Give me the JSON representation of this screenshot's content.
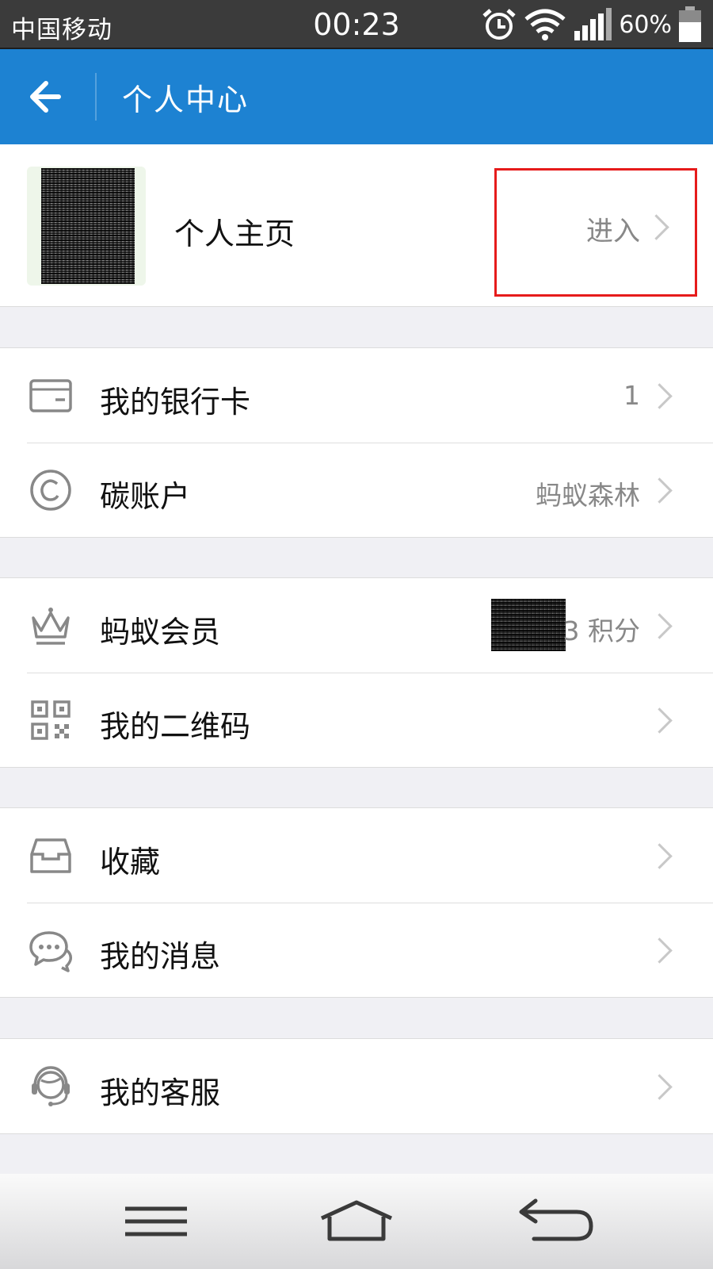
{
  "status_bar": {
    "carrier": "中国移动",
    "time": "00:23",
    "battery": "60%",
    "icons": [
      "alarm-icon",
      "wifi-icon",
      "signal-icon",
      "battery-icon"
    ]
  },
  "header": {
    "back_icon": "back-arrow-icon",
    "title": "个人中心"
  },
  "profile": {
    "title": "个人主页",
    "action": "进入"
  },
  "groups": [
    {
      "rows": [
        {
          "icon": "bank-card-icon",
          "label": "我的银行卡",
          "value": "1"
        },
        {
          "icon": "copyright-c-icon",
          "label": "碳账户",
          "value": "蚂蚁森林"
        }
      ]
    },
    {
      "rows": [
        {
          "icon": "crown-icon",
          "label": "蚂蚁会员",
          "value": "3 积分"
        },
        {
          "icon": "qr-code-icon",
          "label": "我的二维码",
          "value": ""
        }
      ]
    },
    {
      "rows": [
        {
          "icon": "inbox-tray-icon",
          "label": "收藏",
          "value": ""
        },
        {
          "icon": "chat-bubbles-icon",
          "label": "我的消息",
          "value": ""
        }
      ]
    },
    {
      "rows": [
        {
          "icon": "headset-agent-icon",
          "label": "我的客服",
          "value": ""
        }
      ]
    }
  ],
  "nav_bar": {
    "buttons": [
      "menu-icon",
      "home-icon",
      "back-icon"
    ]
  },
  "colors": {
    "header_blue": "#1d82d2",
    "highlight_red": "#e61b1b"
  }
}
